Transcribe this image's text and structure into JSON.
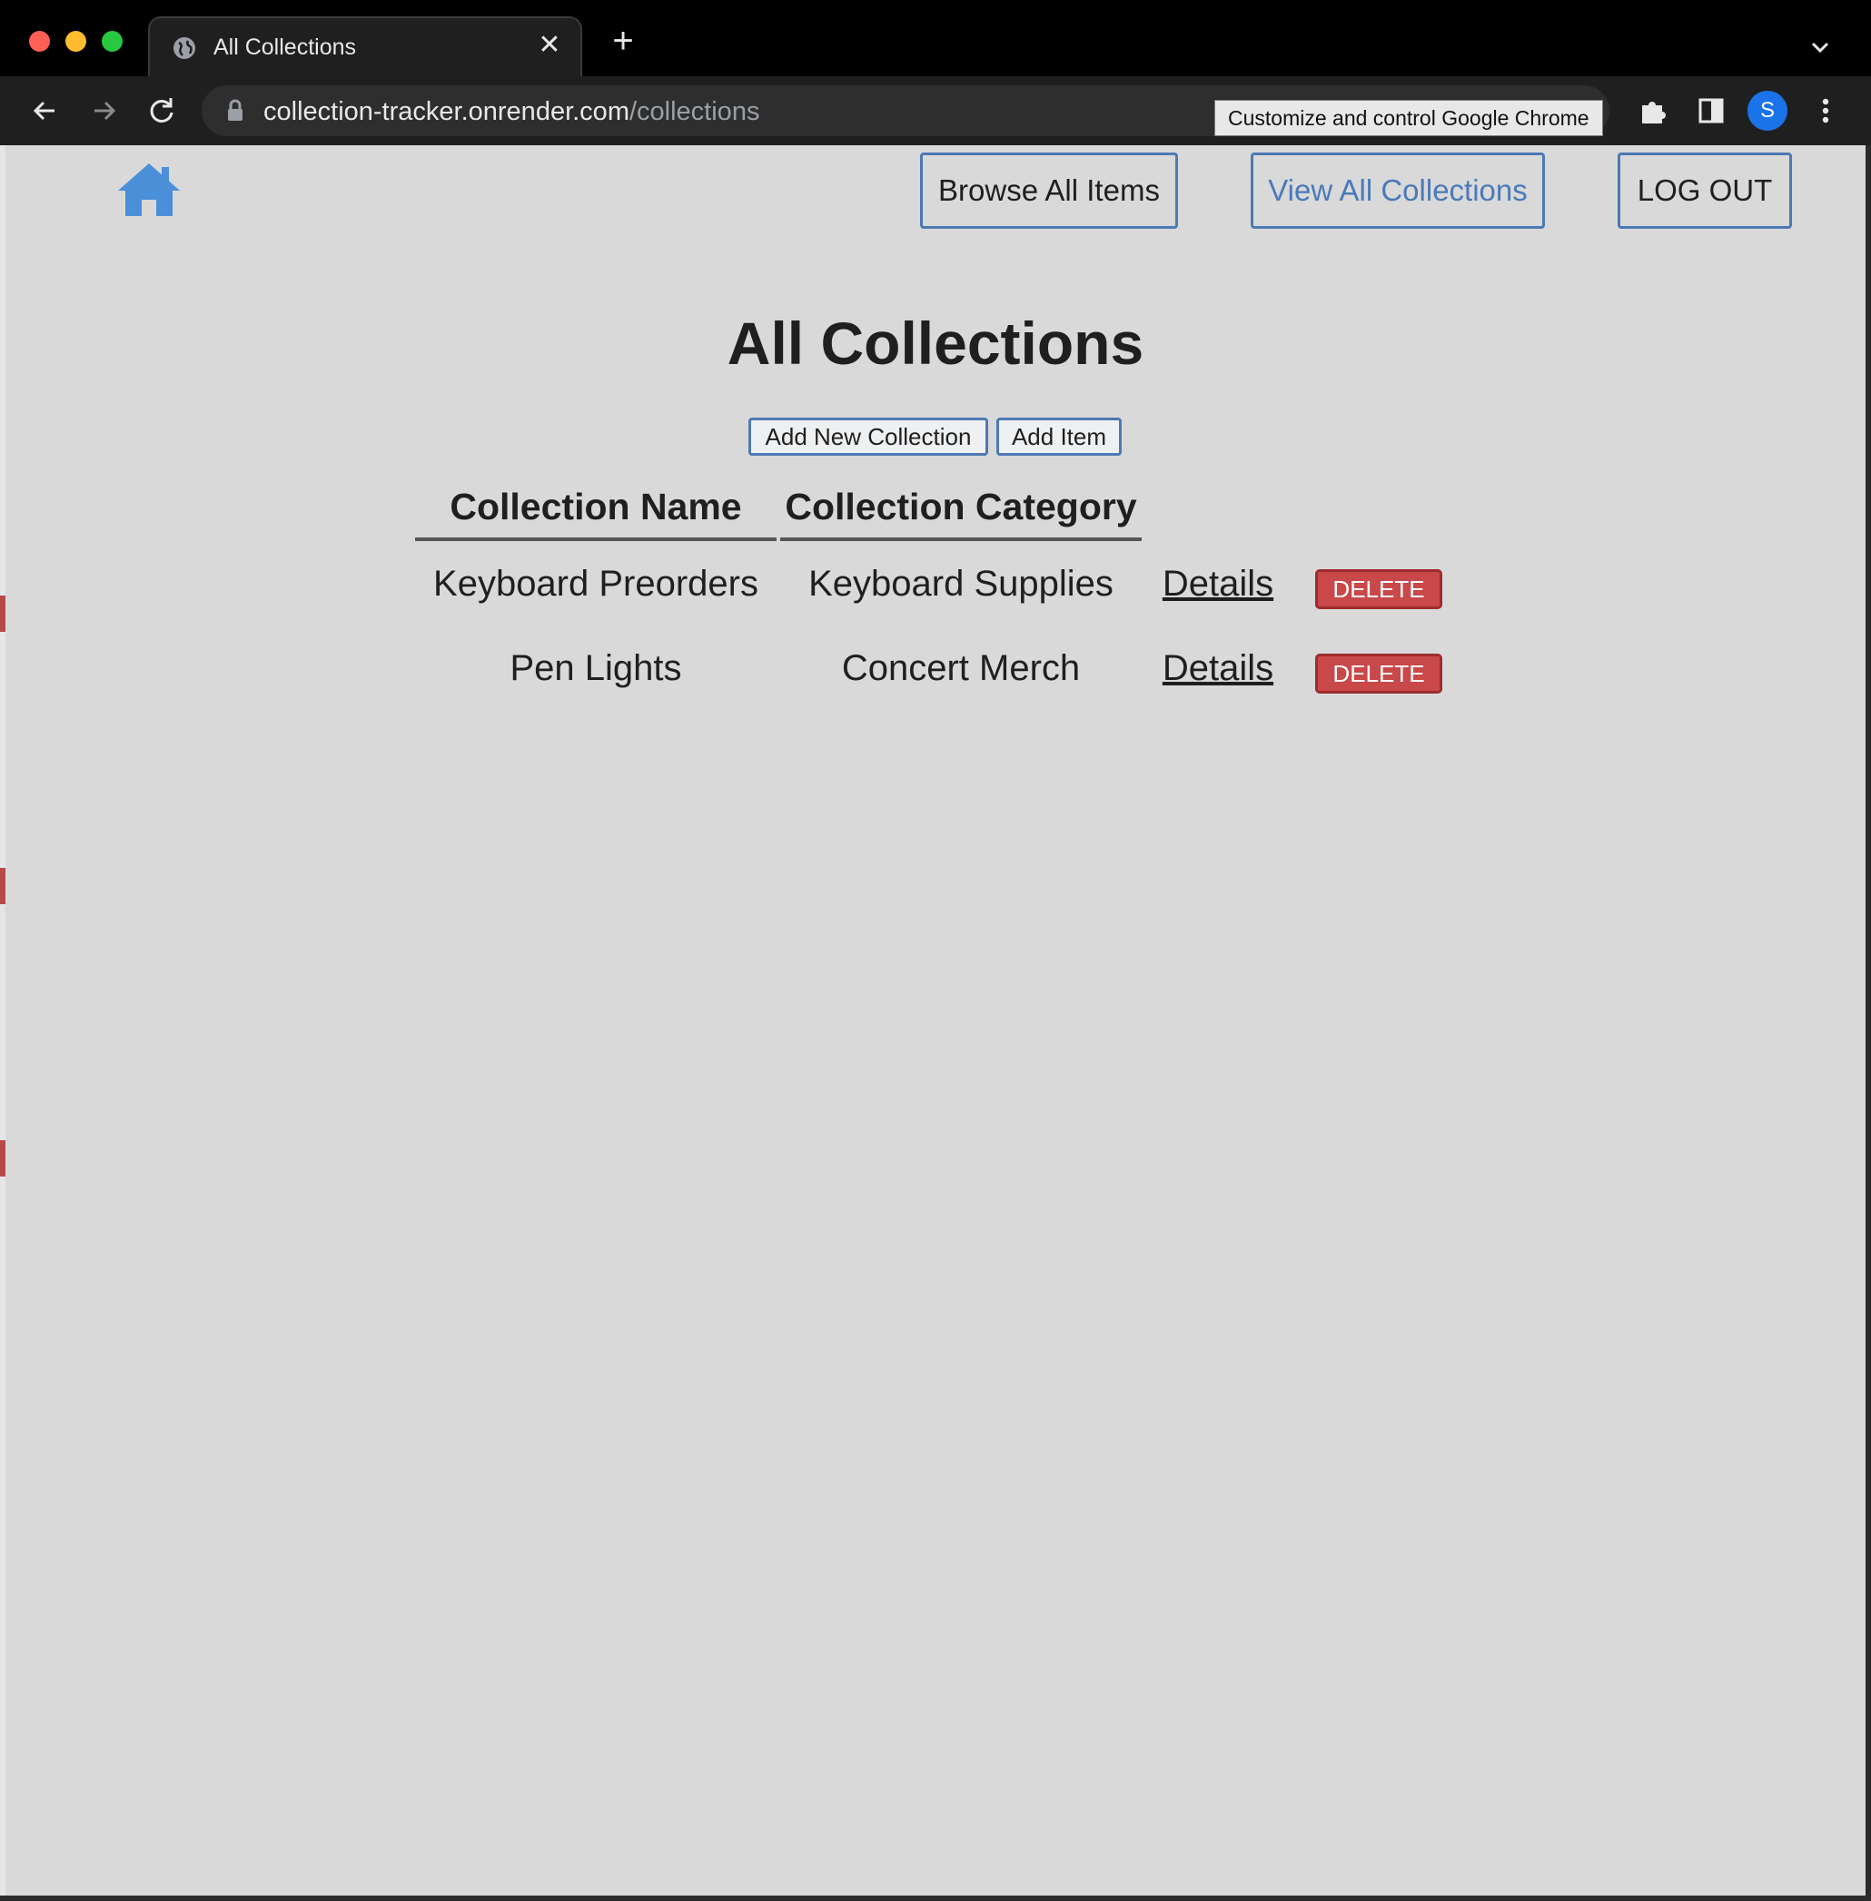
{
  "browser": {
    "tab_title": "All Collections",
    "tab_close": "✕",
    "new_tab": "+",
    "url_host": "collection-tracker.onrender.com",
    "url_path": "/collections",
    "tooltip": "Customize and control Google Chrome",
    "profile_initial": "S"
  },
  "nav": {
    "browse": "Browse All Items",
    "view": "View All Collections",
    "logout": "LOG OUT"
  },
  "page": {
    "title": "All Collections",
    "add_collection": "Add New Collection",
    "add_item": "Add Item"
  },
  "table": {
    "headers": [
      "Collection Name",
      "Collection Category"
    ],
    "rows": [
      {
        "name": "Keyboard Preorders",
        "category": "Keyboard Supplies",
        "details": "Details",
        "delete": "DELETE"
      },
      {
        "name": "Pen Lights",
        "category": "Concert Merch",
        "details": "Details",
        "delete": "DELETE"
      }
    ]
  },
  "colors": {
    "page_bg": "#d9d9d9",
    "accent_blue": "#4d79b3",
    "delete_red": "#c9484a"
  }
}
